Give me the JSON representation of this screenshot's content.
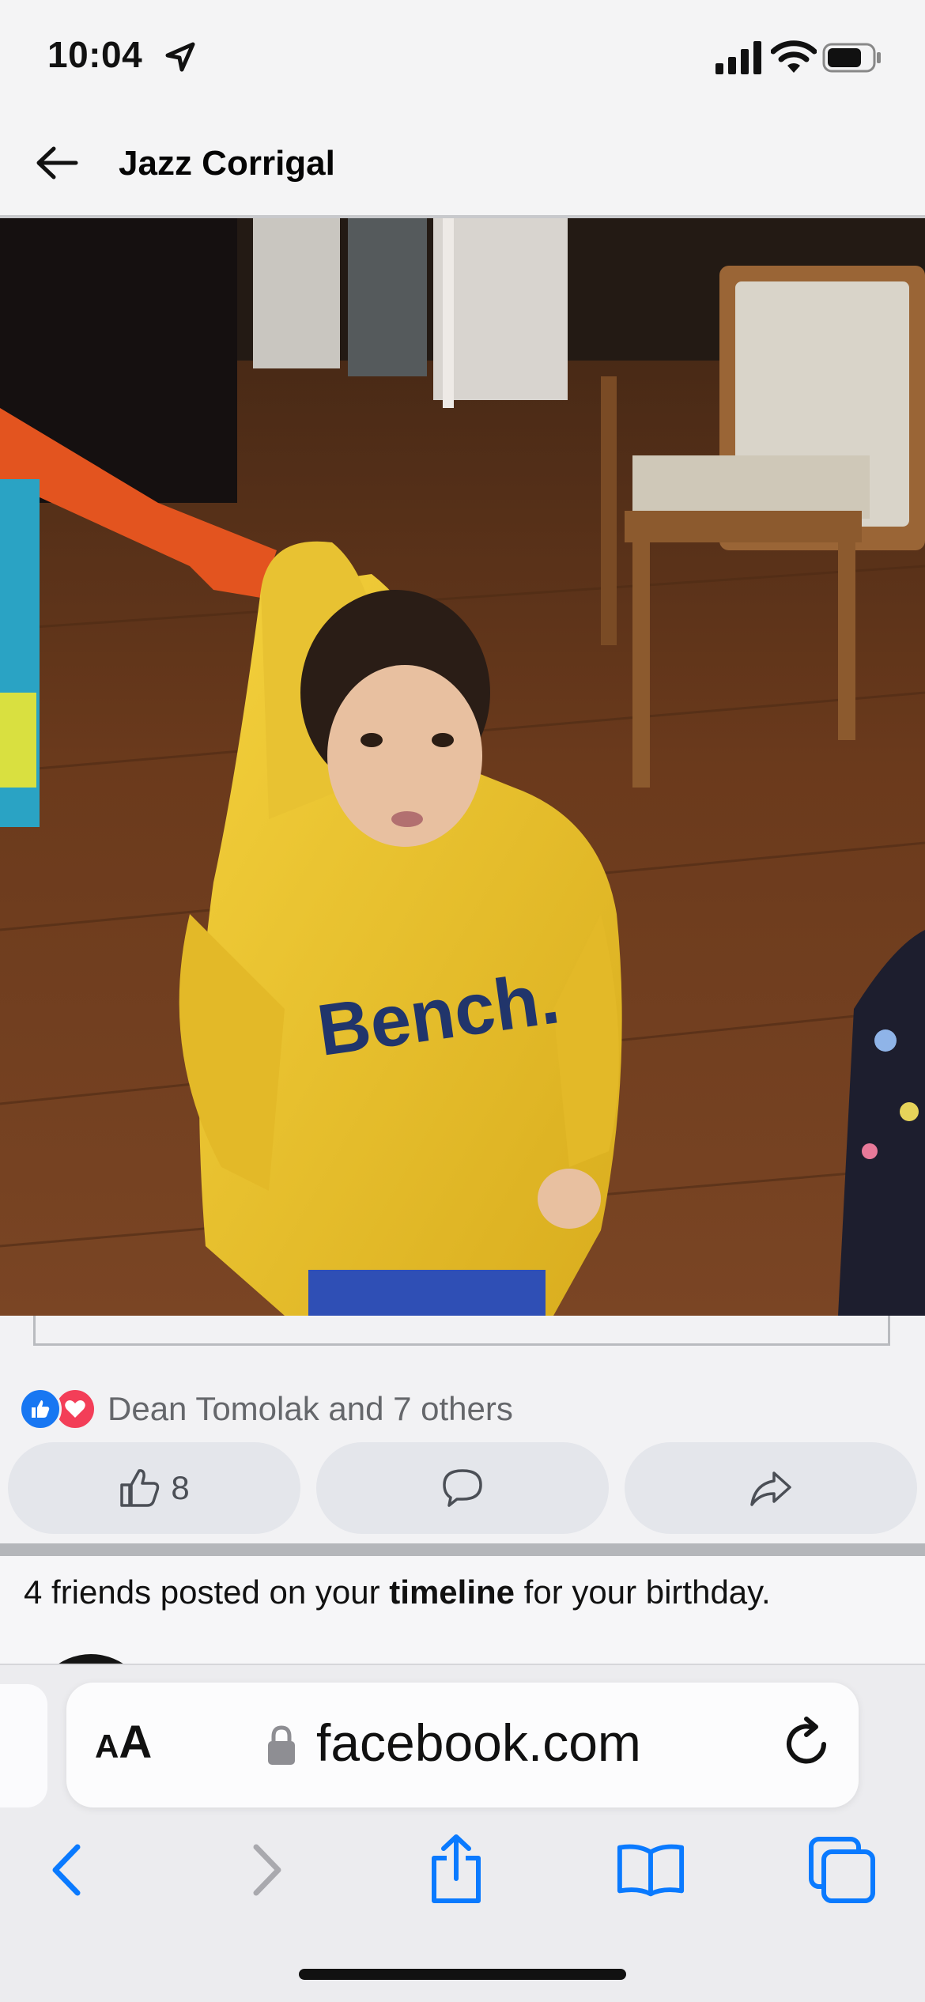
{
  "status_bar": {
    "time": "10:04",
    "icons": [
      "location-arrow-icon",
      "signal-icon",
      "wifi-icon",
      "battery-icon"
    ]
  },
  "header": {
    "title": "Jazz Corrigal",
    "back_icon": "arrow-left-icon"
  },
  "photo": {
    "hoodie_text": "Bench."
  },
  "post": {
    "reactions": [
      "like",
      "love"
    ],
    "reactions_text": "Dean Tomolak and 7 others",
    "like_count": "8",
    "actions": [
      "like-icon",
      "comment-icon",
      "share-icon"
    ]
  },
  "birthday": {
    "prefix": "4 friends posted on your ",
    "bold": "timeline",
    "suffix": " for your birthday."
  },
  "safari": {
    "aa_label_small": "A",
    "aa_label_large": "A",
    "url": "facebook.com",
    "toolbar_icons": [
      "back-icon",
      "forward-icon",
      "share-icon",
      "bookmarks-icon",
      "tabs-icon"
    ]
  },
  "colors": {
    "facebook_blue": "#1877f2",
    "love_red": "#f33e58",
    "safari_blue": "#0a7aff"
  }
}
